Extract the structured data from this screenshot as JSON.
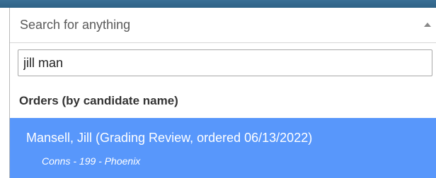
{
  "select": {
    "placeholder": "Search for anything"
  },
  "search": {
    "value": "jill man"
  },
  "results": {
    "group_label": "Orders (by candidate name)",
    "items": [
      {
        "title": "Mansell, Jill (Grading Review, ordered 06/13/2022)",
        "subtitle": "Conns - 199 - Phoenix",
        "highlighted": true
      }
    ]
  },
  "colors": {
    "highlight": "#5897fb",
    "header_strip": "#2f6286"
  }
}
